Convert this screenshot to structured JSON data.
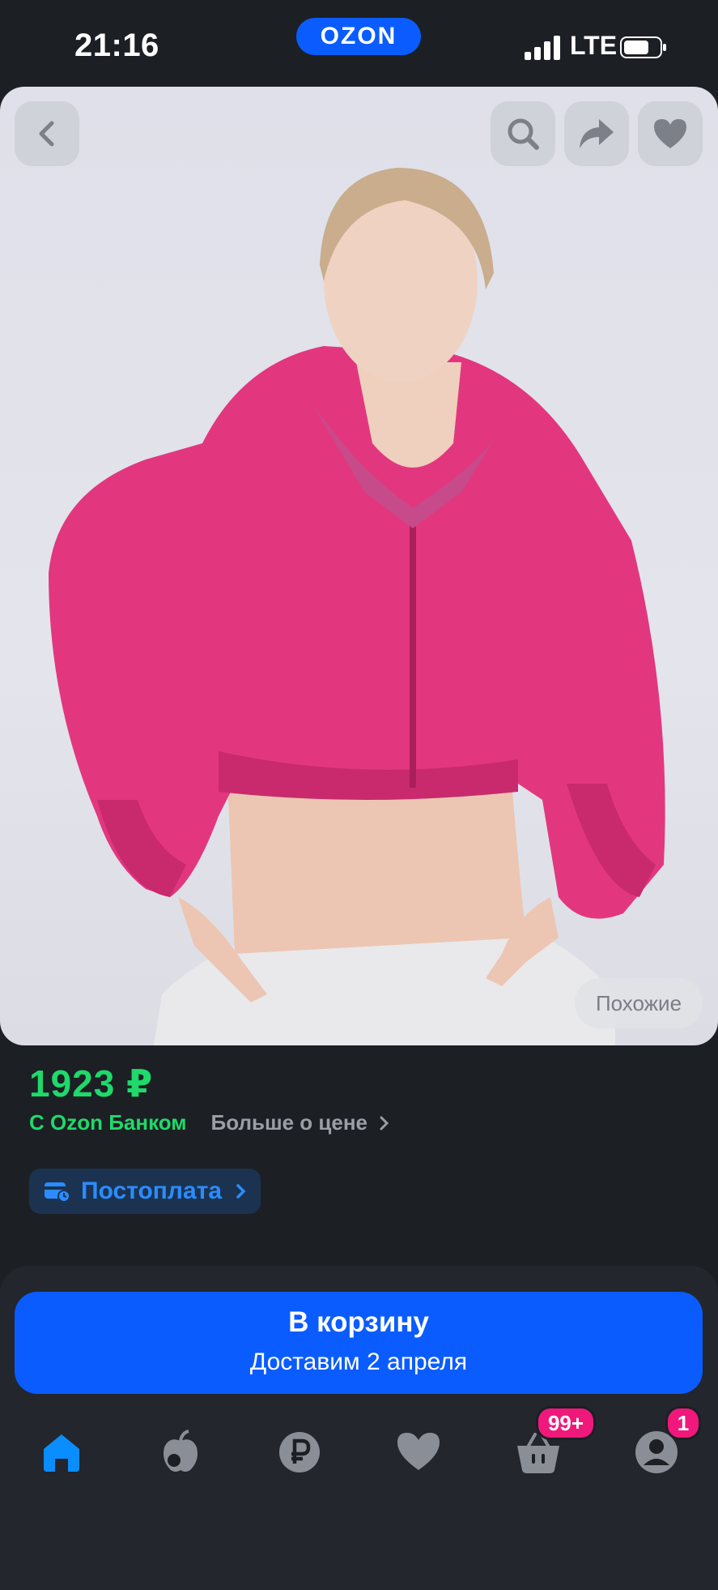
{
  "status_bar": {
    "time": "21:16",
    "network": "LTE",
    "brand": "OZON"
  },
  "product": {
    "price": "1923 ₽",
    "bank_label": "С Ozon Банком",
    "price_more": "Больше о цене",
    "postpay_label": "Постоплата",
    "similar_label": "Похожие"
  },
  "cart": {
    "button_label": "В корзину",
    "delivery_text": "Доставим 2 апреля"
  },
  "nav": {
    "cart_badge": "99+",
    "profile_badge": "1"
  },
  "colors": {
    "accent": "#0a5cff",
    "price_green": "#1fd96b",
    "badge_pink": "#f0187b",
    "background": "#1c1f24"
  }
}
